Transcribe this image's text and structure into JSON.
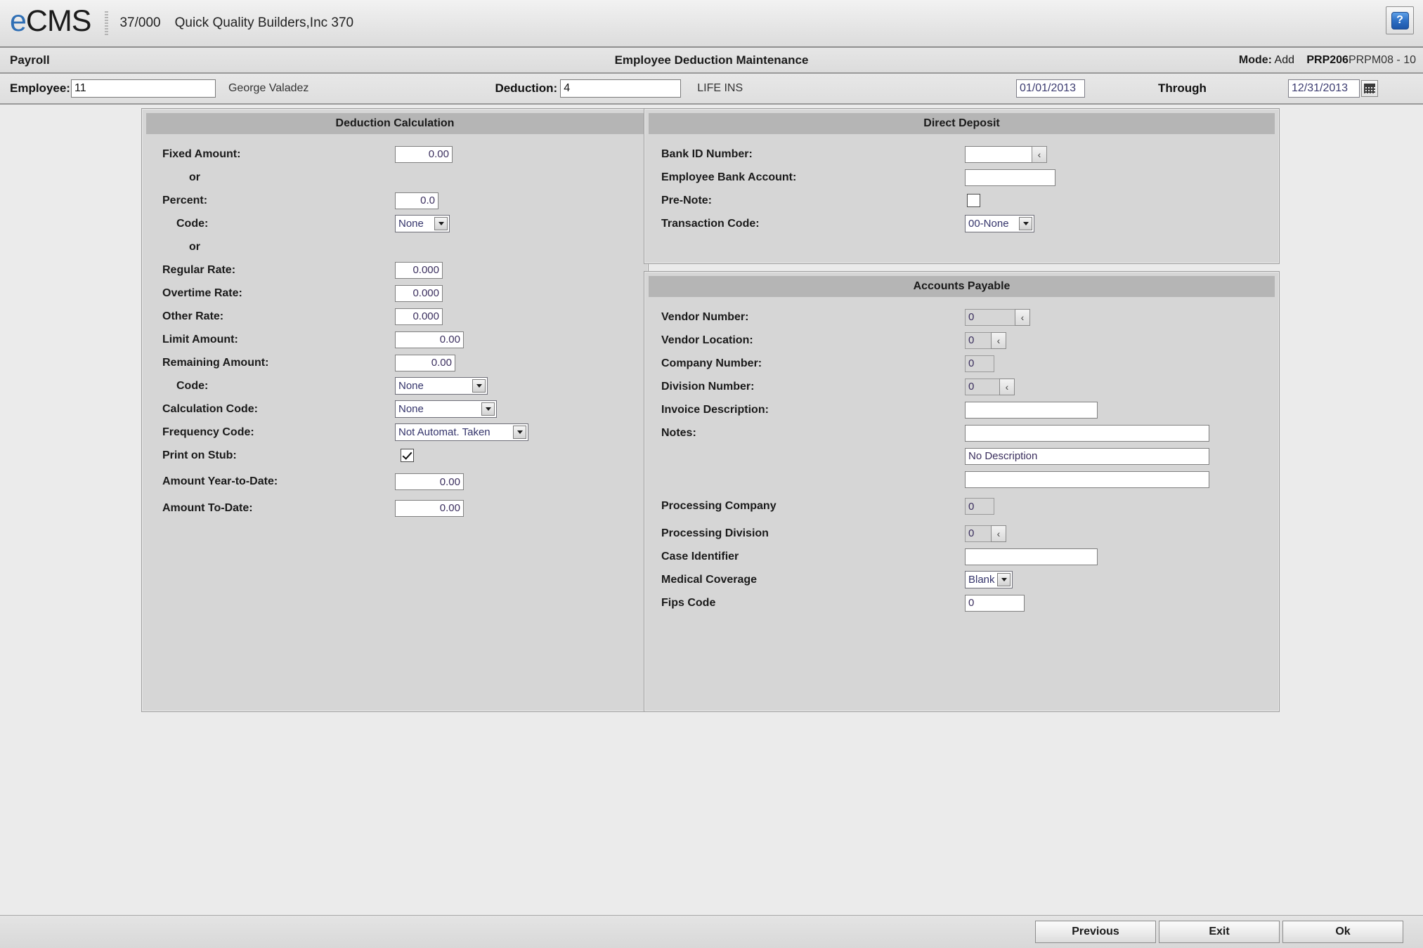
{
  "brand": {
    "logo_text_e": "e",
    "logo_text_rest": "CMS",
    "company_code": "37/000",
    "company_name": "Quick Quality Builders,Inc 370",
    "help_icon": "question-mark-icon",
    "help_label": "?"
  },
  "modulebar": {
    "module": "Payroll",
    "title": "Employee Deduction Maintenance",
    "mode_label": "Mode:",
    "mode_value": "Add",
    "program_id": "PRP206",
    "program_suffix": "PRPM08 - 10"
  },
  "keybar": {
    "employee_label": "Employee:",
    "employee_value": "11",
    "employee_name": "George Valadez",
    "deduction_label": "Deduction:",
    "deduction_value": "4",
    "deduction_name": "LIFE INS",
    "effective_date": "01/01/2013",
    "through_label": "Through",
    "through_date": "12/31/2013",
    "calendar_icon": "calendar-icon"
  },
  "deduction_calculation": {
    "title": "Deduction Calculation",
    "fixed_amount_label": "Fixed Amount:",
    "fixed_amount_value": "0.00",
    "or_1": "or",
    "percent_label": "Percent:",
    "percent_value": "0.0",
    "percent_code_label": "Code:",
    "percent_code_value": "None",
    "or_2": "or",
    "regular_rate_label": "Regular Rate:",
    "regular_rate_value": "0.000",
    "overtime_rate_label": "Overtime Rate:",
    "overtime_rate_value": "0.000",
    "other_rate_label": "Other Rate:",
    "other_rate_value": "0.000",
    "limit_amount_label": "Limit Amount:",
    "limit_amount_value": "0.00",
    "remaining_amount_label": "Remaining Amount:",
    "remaining_amount_value": "0.00",
    "remaining_code_label": "Code:",
    "remaining_code_value": "None",
    "calculation_code_label": "Calculation Code:",
    "calculation_code_value": "None",
    "frequency_code_label": "Frequency Code:",
    "frequency_code_value": "Not Automat. Taken",
    "print_on_stub_label": "Print on Stub:",
    "print_on_stub_checked": true,
    "amount_ytd_label": "Amount Year-to-Date:",
    "amount_ytd_value": "0.00",
    "amount_todate_label": "Amount To-Date:",
    "amount_todate_value": "0.00"
  },
  "direct_deposit": {
    "title": "Direct Deposit",
    "bank_id_label": "Bank ID Number:",
    "bank_id_value": "",
    "bank_id_lookup_icon": "lookup-chevron-icon",
    "employee_bank_account_label": "Employee Bank Account:",
    "employee_bank_account_value": "",
    "prenote_label": "Pre-Note:",
    "prenote_checked": false,
    "transaction_code_label": "Transaction Code:",
    "transaction_code_value": "00-None"
  },
  "accounts_payable": {
    "title": "Accounts Payable",
    "vendor_number_label": "Vendor Number:",
    "vendor_number_value": "0",
    "vendor_location_label": "Vendor Location:",
    "vendor_location_value": "0",
    "company_number_label": "Company Number:",
    "company_number_value": "0",
    "division_number_label": "Division Number:",
    "division_number_value": "0",
    "invoice_description_label": "Invoice Description:",
    "invoice_description_value": "",
    "notes_label": "Notes:",
    "notes_line1": "",
    "notes_line2": "No Description",
    "notes_line3": "",
    "processing_company_label": "Processing Company",
    "processing_company_value": "0",
    "processing_division_label": "Processing Division",
    "processing_division_value": "0",
    "case_identifier_label": "Case Identifier",
    "case_identifier_value": "",
    "medical_coverage_label": "Medical Coverage",
    "medical_coverage_value": "Blank",
    "fips_code_label": "Fips Code",
    "fips_code_value": "0",
    "lookup_icon": "lookup-chevron-icon",
    "lookup_glyph": "‹"
  },
  "buttons": {
    "previous": "Previous",
    "exit": "Exit",
    "ok": "Ok"
  },
  "colors": {
    "accent_blue": "#2f6fb5",
    "panel_bg": "#d6d6d6",
    "panel_header": "#b5b5b5",
    "page_bg": "#ebebeb",
    "field_text": "#3b2f5e"
  }
}
